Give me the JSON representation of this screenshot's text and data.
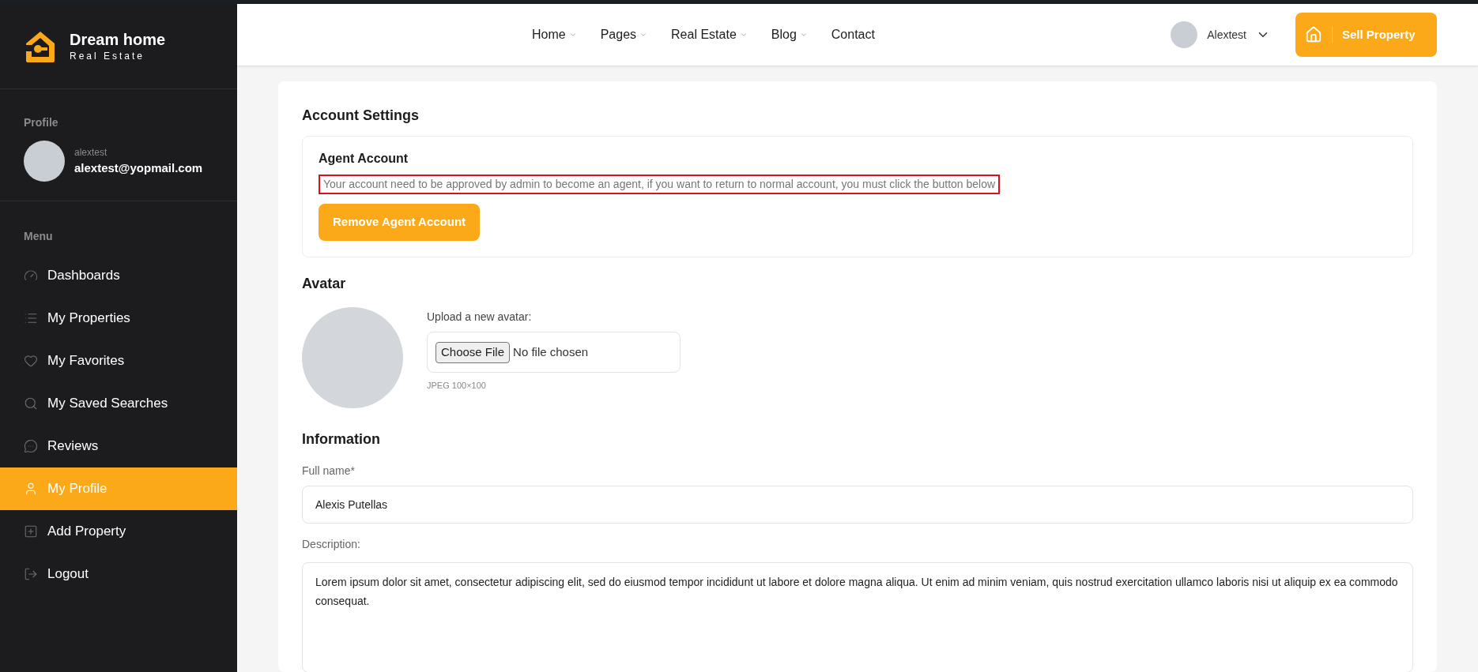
{
  "brand": {
    "name": "Dream home",
    "tagline": "Real Estate"
  },
  "profile": {
    "heading": "Profile",
    "username": "alextest",
    "email": "alextest@yopmail.com"
  },
  "menu": {
    "heading": "Menu",
    "items": [
      {
        "label": "Dashboards",
        "selected": false
      },
      {
        "label": "My Properties",
        "selected": false
      },
      {
        "label": "My Favorites",
        "selected": false
      },
      {
        "label": "My Saved Searches",
        "selected": false
      },
      {
        "label": "Reviews",
        "selected": false
      },
      {
        "label": "My Profile",
        "selected": true
      },
      {
        "label": "Add Property",
        "selected": false
      },
      {
        "label": "Logout",
        "selected": false
      }
    ]
  },
  "nav": [
    {
      "label": "Home",
      "dropdown": true
    },
    {
      "label": "Pages",
      "dropdown": true
    },
    {
      "label": "Real Estate",
      "dropdown": true
    },
    {
      "label": "Blog",
      "dropdown": true
    },
    {
      "label": "Contact",
      "dropdown": false
    }
  ],
  "user_menu": {
    "name": "Alextest"
  },
  "sell_button": "Sell Property",
  "account_settings": {
    "title": "Account Settings",
    "agent": {
      "title": "Agent Account",
      "notice": "Your account need to be approved by admin to become an agent, if you want to return to normal account, you must click the button below",
      "button": "Remove Agent Account"
    }
  },
  "avatar": {
    "title": "Avatar",
    "upload_label": "Upload a new avatar:",
    "choose_button": "Choose File",
    "file_status": "No file chosen",
    "hint": "JPEG 100×100"
  },
  "information": {
    "title": "Information",
    "fields": [
      {
        "label": "Full name*",
        "value": "Alexis Putellas",
        "kind": "input"
      },
      {
        "label": "Description:",
        "value": "Lorem ipsum dolor sit amet, consectetur adipiscing elit, sed do eiusmod tempor incididunt ut labore et dolore magna aliqua. Ut enim ad minim veniam, quis nostrud exercitation ullamco laboris nisi ut aliquip ex ea commodo consequat.",
        "kind": "textarea"
      }
    ]
  }
}
